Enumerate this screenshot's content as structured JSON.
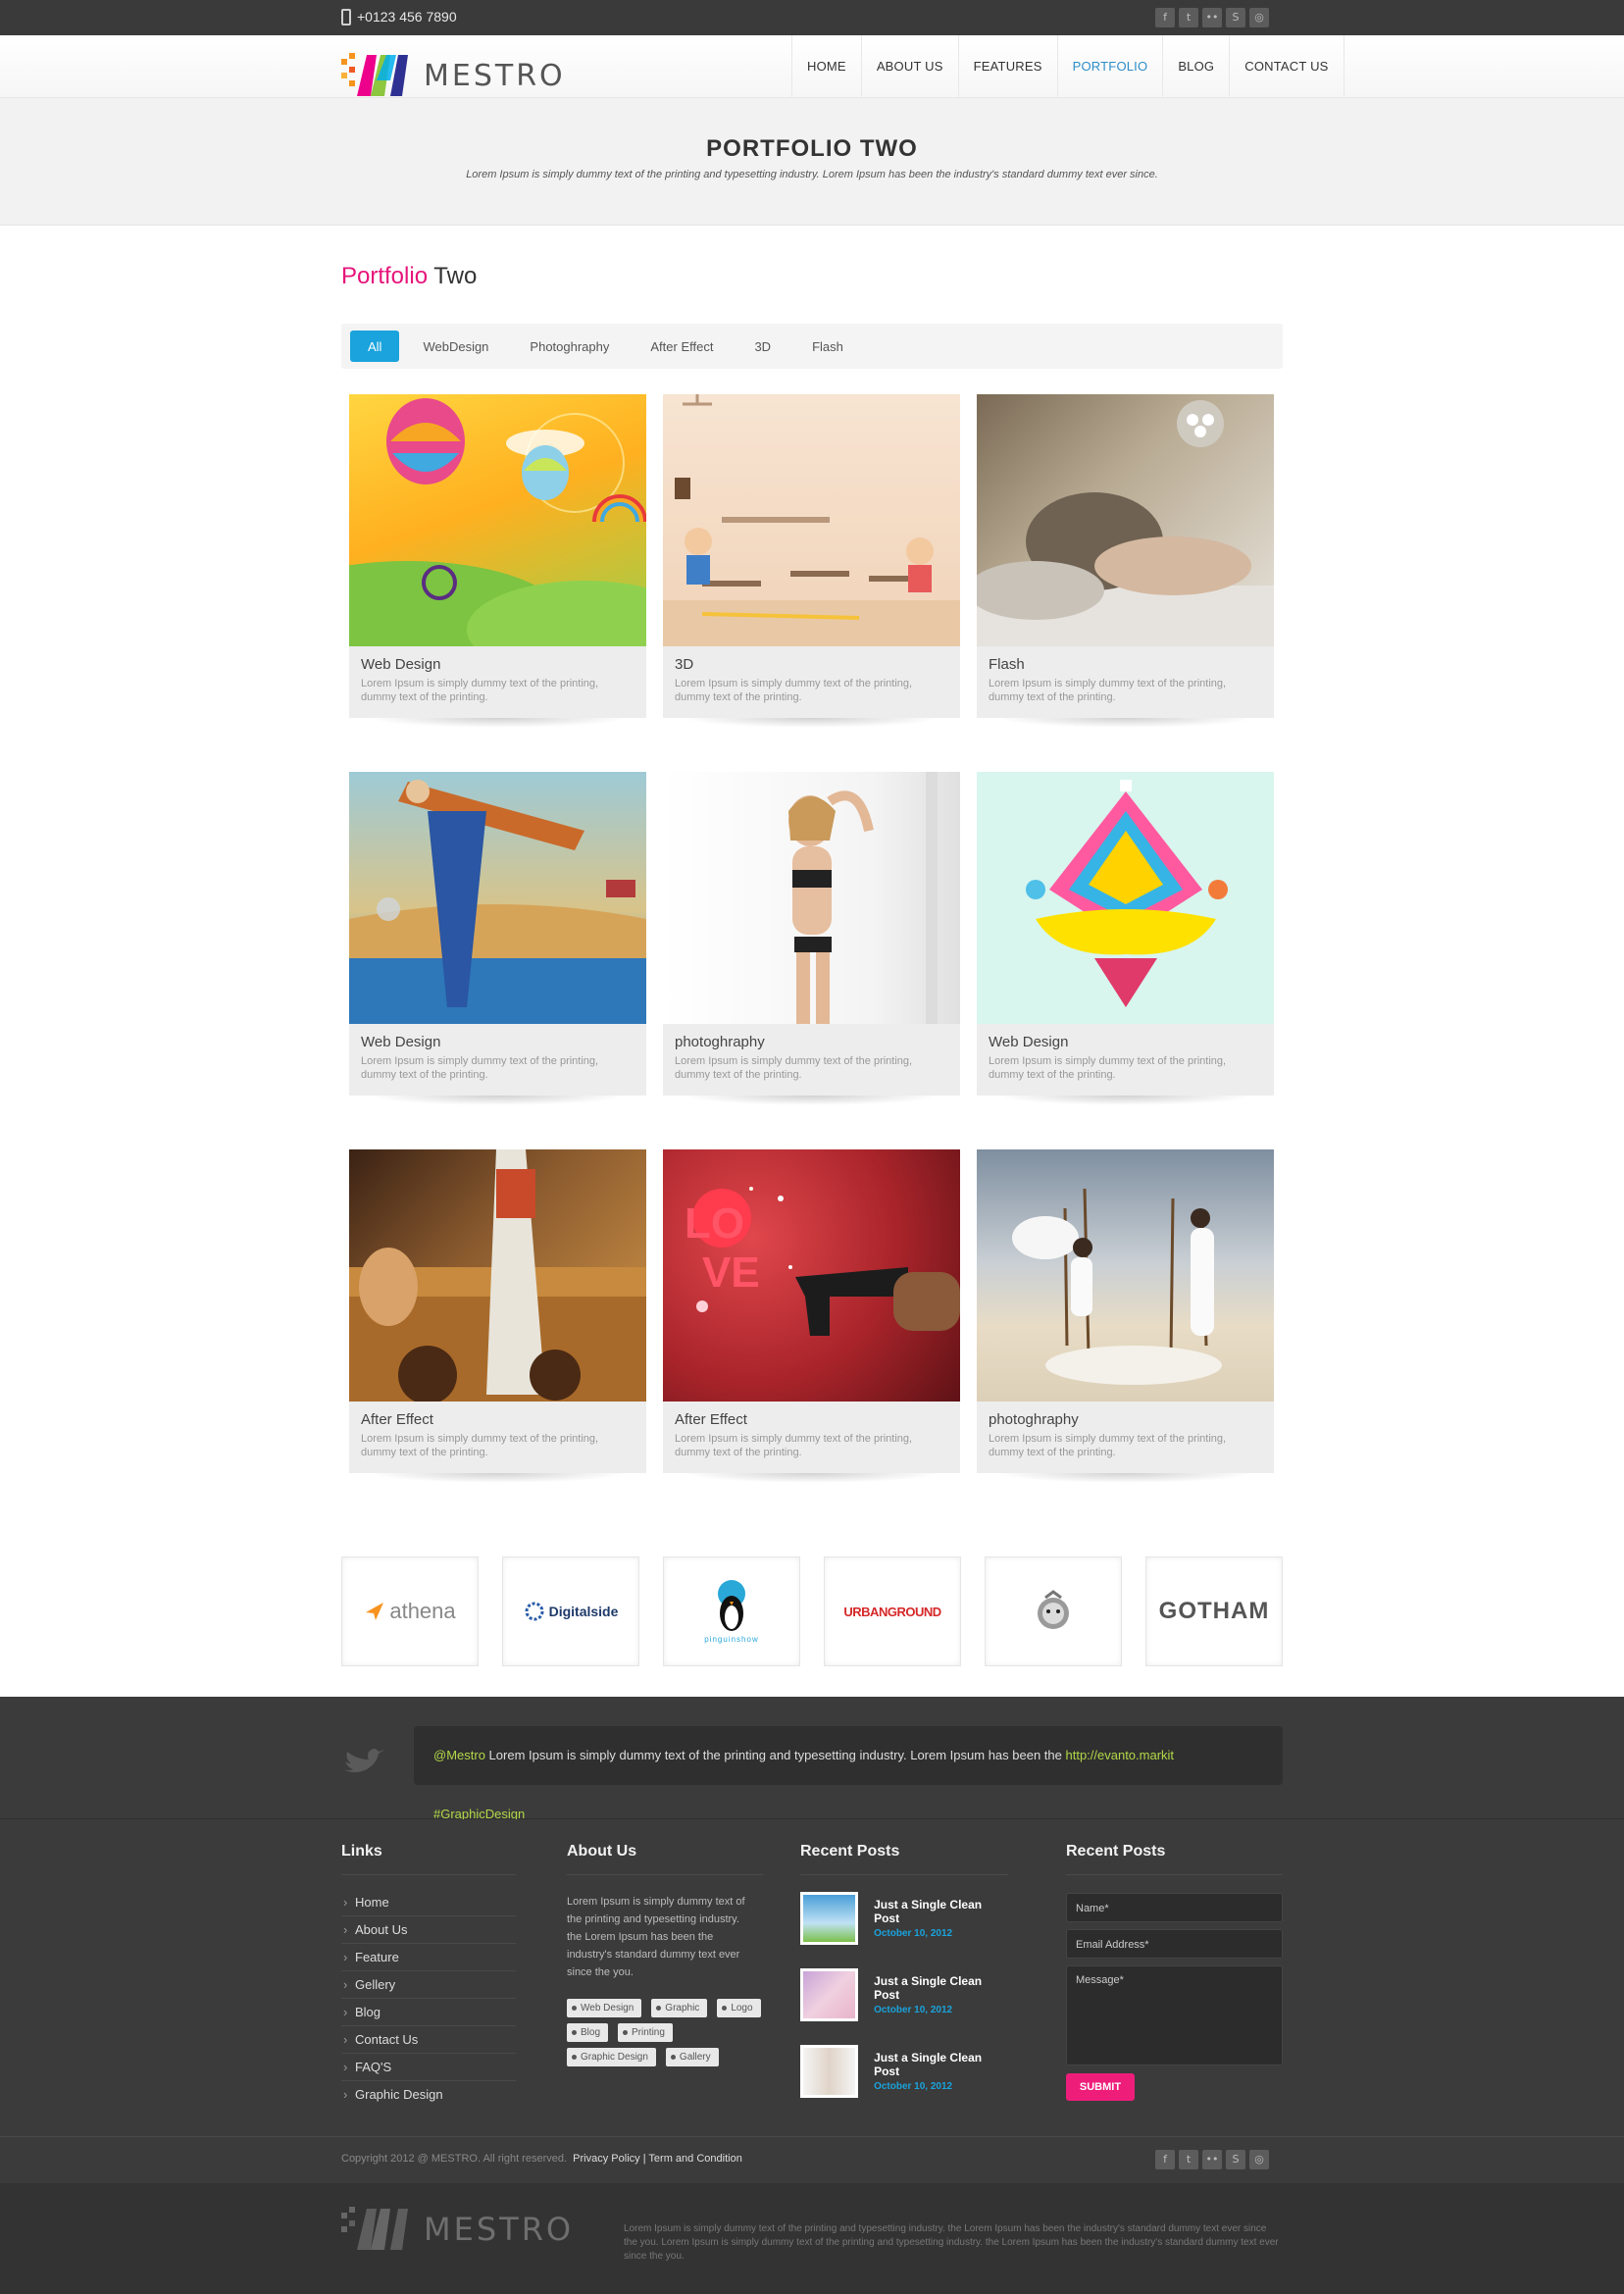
{
  "topbar": {
    "phone": "+0123 456 7890",
    "social_icons": [
      "facebook-icon",
      "twitter-icon",
      "flickr-icon",
      "skype-icon",
      "dribbble-icon"
    ]
  },
  "header": {
    "logo_text": "MESTRO",
    "nav": [
      {
        "label": "HOME"
      },
      {
        "label": "ABOUT US"
      },
      {
        "label": "FEATURES"
      },
      {
        "label": "PORTFOLIO",
        "active": true
      },
      {
        "label": "BLOG"
      },
      {
        "label": "CONTACT US"
      }
    ]
  },
  "banner": {
    "title": "PORTFOLIO TWO",
    "subtitle": "Lorem Ipsum is simply dummy text of the printing and typesetting industry. Lorem Ipsum has been the industry's standard dummy text ever since."
  },
  "section": {
    "title_accent": "Portfolio",
    "title_rest": "Two"
  },
  "filters": [
    "All",
    "WebDesign",
    "Photoghraphy",
    "After Effect",
    "3D",
    "Flash"
  ],
  "portfolio": [
    {
      "title": "Web Design",
      "desc": "Lorem Ipsum is simply dummy text of the printing, dummy text of the printing."
    },
    {
      "title": "3D",
      "desc": "Lorem Ipsum is simply dummy text of the printing, dummy text of the printing."
    },
    {
      "title": "Flash",
      "desc": "Lorem Ipsum is simply dummy text of the printing, dummy text of the printing."
    },
    {
      "title": "Web Design",
      "desc": "Lorem Ipsum is simply dummy text of the printing, dummy text of the printing."
    },
    {
      "title": "photoghraphy",
      "desc": "Lorem Ipsum is simply dummy text of the printing, dummy text of the printing."
    },
    {
      "title": "Web Design",
      "desc": "Lorem Ipsum is simply dummy text of the printing, dummy text of the printing."
    },
    {
      "title": "After Effect",
      "desc": "Lorem Ipsum is simply dummy text of the printing, dummy text of the printing."
    },
    {
      "title": "After Effect",
      "desc": "Lorem Ipsum is simply dummy text of the printing, dummy text of the printing."
    },
    {
      "title": "photoghraphy",
      "desc": "Lorem Ipsum is simply dummy text of the printing, dummy text of the printing."
    }
  ],
  "clients": [
    "athena",
    "Digitalside",
    "pinguinshow",
    "URBANGROUND",
    "",
    "GOTHAM"
  ],
  "tweet": {
    "handle": "@Mestro",
    "text": " Lorem Ipsum is simply dummy text of the printing and typesetting industry. Lorem Ipsum has been the ",
    "link": "http://evanto.markit #GraphicDesign"
  },
  "footer": {
    "links_title": "Links",
    "links": [
      "Home",
      "About Us",
      "Feature",
      "Gellery",
      "Blog",
      "Contact Us",
      "FAQ'S",
      "Graphic Design"
    ],
    "about_title": "About Us",
    "about_text": "Lorem Ipsum is simply dummy text of the printing and typesetting industry. the Lorem Ipsum has been the industry's standard dummy text ever since the you.",
    "tags": [
      "Web Design",
      "Graphic",
      "Logo",
      "Blog",
      "Printing",
      "Graphic Design",
      "Gallery"
    ],
    "posts_title": "Recent Posts",
    "posts": [
      {
        "title": "Just a Single Clean Post",
        "date": "October 10, 2012"
      },
      {
        "title": "Just a Single Clean Post",
        "date": "October 10, 2012"
      },
      {
        "title": "Just a Single Clean Post",
        "date": "October 10, 2012"
      }
    ],
    "form_title": "Recent Posts",
    "form": {
      "name_placeholder": "Name*",
      "email_placeholder": "Email Address*",
      "message_placeholder": "Message*",
      "submit": "SUBMIT"
    }
  },
  "copyright": {
    "text": "Copyright 2012 @ MESTRO. All right reserved.",
    "privacy": "Privacy Policy",
    "sep": "|",
    "terms": "Term and Condition"
  },
  "bottom": {
    "logo_text": "MESTRO",
    "text": "Lorem Ipsum is simply dummy text of the printing and typesetting industry. the Lorem Ipsum has been the industry's standard dummy text ever since the you. Lorem Ipsum is simply dummy text of the printing and typesetting industry. the Lorem Ipsum has been the industry's standard dummy text ever since the you."
  },
  "colors": {
    "accent_pink": "#e6147a",
    "accent_blue": "#1aa3dc",
    "dark_bg": "#3b3b3b"
  }
}
